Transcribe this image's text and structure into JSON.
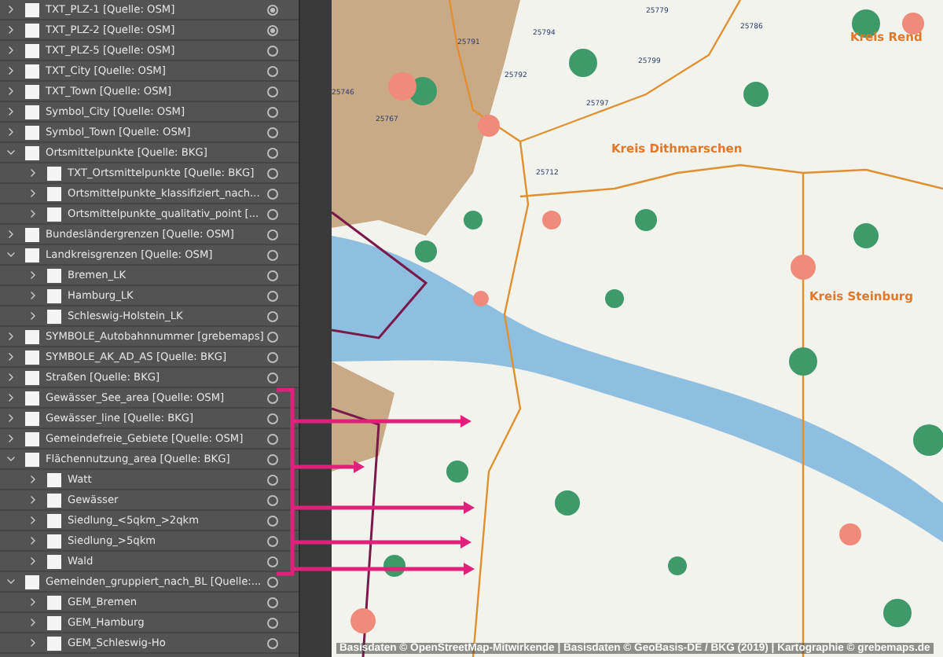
{
  "layers": [
    {
      "name": "TXT_PLZ-1 [Quelle: OSM]",
      "expanded": false,
      "targeted": true
    },
    {
      "name": "TXT_PLZ-2 [Quelle: OSM]",
      "expanded": false,
      "targeted": true
    },
    {
      "name": "TXT_PLZ-5 [Quelle: OSM]",
      "expanded": false,
      "targeted": false
    },
    {
      "name": "TXT_City [Quelle: OSM]",
      "expanded": false,
      "targeted": false
    },
    {
      "name": "TXT_Town [Quelle: OSM]",
      "expanded": false,
      "targeted": false
    },
    {
      "name": "Symbol_City [Quelle: OSM]",
      "expanded": false,
      "targeted": false
    },
    {
      "name": "Symbol_Town [Quelle: OSM]",
      "expanded": false,
      "targeted": false
    },
    {
      "name": "Ortsmittelpunkte [Quelle: BKG]",
      "expanded": true,
      "targeted": false,
      "children": [
        {
          "name": "TXT_Ortsmittelpunkte [Quelle: BKG]",
          "expanded": false,
          "targeted": false
        },
        {
          "name": "Ortsmittelpunkte_klassifiziert_nach...",
          "expanded": false,
          "targeted": false
        },
        {
          "name": "Ortsmittelpunkte_qualitativ_point [...",
          "expanded": false,
          "targeted": false
        }
      ]
    },
    {
      "name": "Bundesländergrenzen [Quelle: OSM]",
      "expanded": false,
      "targeted": false
    },
    {
      "name": "Landkreisgrenzen [Quelle: OSM]",
      "expanded": true,
      "targeted": false,
      "children": [
        {
          "name": "Bremen_LK",
          "expanded": false,
          "targeted": false
        },
        {
          "name": "Hamburg_LK",
          "expanded": false,
          "targeted": false
        },
        {
          "name": "Schleswig-Holstein_LK",
          "expanded": false,
          "targeted": false
        }
      ]
    },
    {
      "name": "SYMBOLE_Autobahnnummer [grebemaps]",
      "expanded": false,
      "targeted": false
    },
    {
      "name": "SYMBOLE_AK_AD_AS [Quelle: BKG]",
      "expanded": false,
      "targeted": false
    },
    {
      "name": "Straßen [Quelle: BKG]",
      "expanded": false,
      "targeted": false
    },
    {
      "name": "Gewässer_See_area [Quelle: OSM]",
      "expanded": false,
      "targeted": false
    },
    {
      "name": "Gewässer_line [Quelle: BKG]",
      "expanded": false,
      "targeted": false
    },
    {
      "name": "Gemeindefreie_Gebiete [Quelle: OSM]",
      "expanded": false,
      "targeted": false
    },
    {
      "name": "Flächennutzung_area [Quelle: BKG]",
      "expanded": true,
      "targeted": false,
      "children": [
        {
          "name": "Watt",
          "expanded": false,
          "targeted": false
        },
        {
          "name": "Gewässer",
          "expanded": false,
          "targeted": false
        },
        {
          "name": "Siedlung_<5qkm_>2qkm",
          "expanded": false,
          "targeted": false
        },
        {
          "name": "Siedlung_>5qkm",
          "expanded": false,
          "targeted": false
        },
        {
          "name": "Wald",
          "expanded": false,
          "targeted": false
        }
      ]
    },
    {
      "name": "Gemeinden_gruppiert_nach_BL [Quelle:...",
      "expanded": true,
      "targeted": false,
      "children": [
        {
          "name": "GEM_Bremen",
          "expanded": false,
          "targeted": false
        },
        {
          "name": "GEM_Hamburg",
          "expanded": false,
          "targeted": false
        },
        {
          "name": "GEM_Schleswig-Ho",
          "expanded": false,
          "targeted": false
        }
      ]
    }
  ],
  "map_labels": [
    {
      "text": "Kreis Rend",
      "kind": "district"
    },
    {
      "text": "25779",
      "kind": "postcode"
    },
    {
      "text": "25786",
      "kind": "postcode"
    },
    {
      "text": "25794",
      "kind": "postcode"
    },
    {
      "text": "25791",
      "kind": "postcode"
    },
    {
      "text": "25799",
      "kind": "postcode"
    },
    {
      "text": "25792",
      "kind": "postcode"
    },
    {
      "text": "25746",
      "kind": "postcode"
    },
    {
      "text": "25797",
      "kind": "postcode"
    },
    {
      "text": "25767",
      "kind": "postcode"
    },
    {
      "text": "Kreis Dithmarschen",
      "kind": "district"
    },
    {
      "text": "25712",
      "kind": "postcode"
    },
    {
      "text": "Kreis Steinburg",
      "kind": "district"
    }
  ],
  "attribution": "Basisdaten © OpenStreetMap-Mitwirkende | Basisdaten © GeoBasis-DE / BKG (2019) | Kartographie © grebemaps.de"
}
